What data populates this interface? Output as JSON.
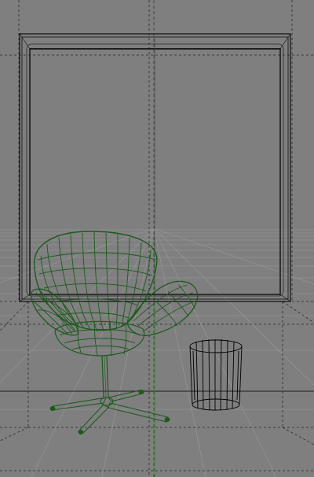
{
  "viewport": {
    "kind": "3d-wireframe-viewport",
    "background_color": "#7f7f7f",
    "grid_color": "#9a9a9a",
    "dashed_line_color": "#2a2a2a",
    "vertical_axis_color": "#2f8f2f",
    "objects": [
      {
        "name": "window-frame",
        "wire_color": "#000000",
        "selected": false
      },
      {
        "name": "swan-chair",
        "wire_color": "#1d5a1d",
        "selected": true
      },
      {
        "name": "wastebasket",
        "wire_color": "#000000",
        "selected": false
      }
    ]
  }
}
